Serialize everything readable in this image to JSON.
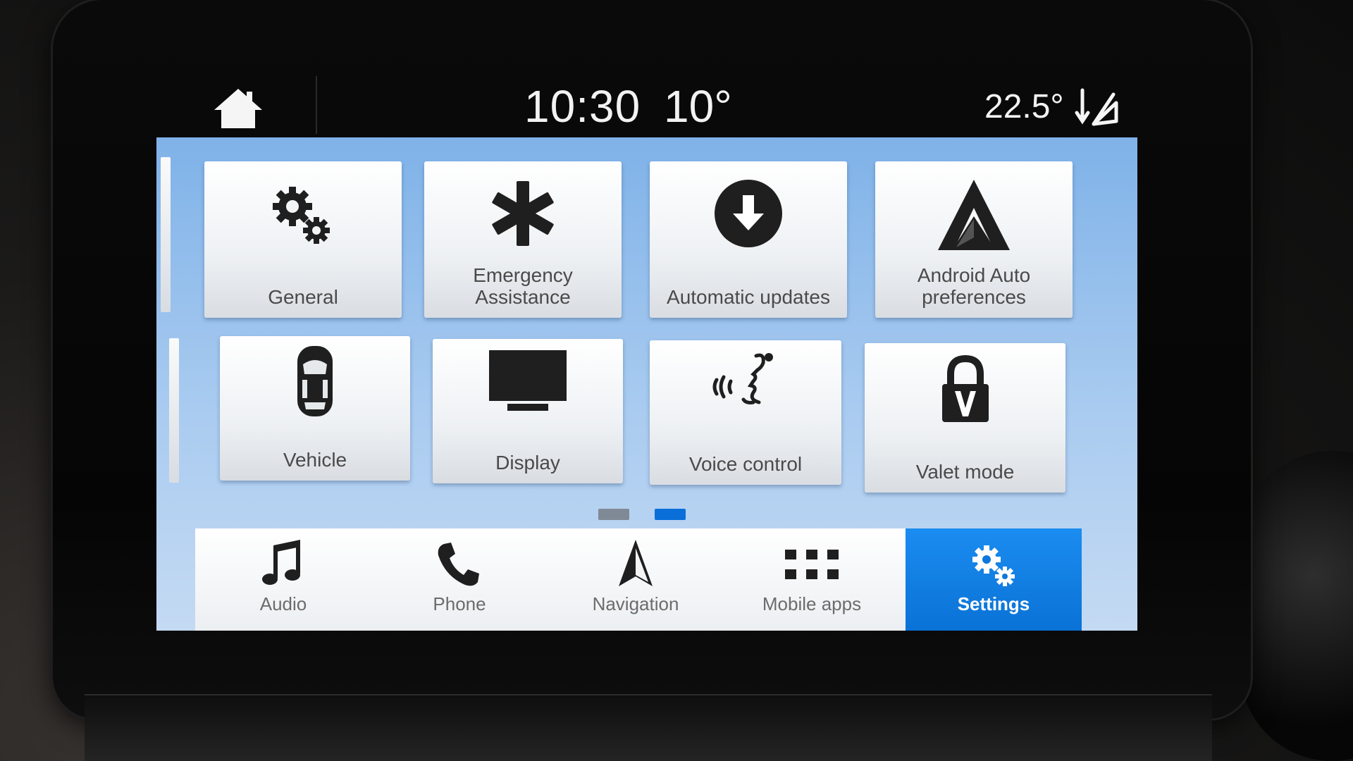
{
  "status_bar": {
    "time": "10:30",
    "outside_temperature": "10°",
    "cabin_temperature": "22.5°",
    "home_icon": "home-icon",
    "climate_icon": "airflow-icon"
  },
  "settings_grid": {
    "tiles": [
      {
        "label": "General",
        "icon": "gears-icon"
      },
      {
        "label": "Emergency\nAssistance",
        "icon": "asterisk-icon"
      },
      {
        "label": "Automatic updates",
        "icon": "download-circle-icon"
      },
      {
        "label": "Android Auto\npreferences",
        "icon": "android-auto-icon"
      },
      {
        "label": "Vehicle",
        "icon": "car-icon"
      },
      {
        "label": "Display",
        "icon": "monitor-icon"
      },
      {
        "label": "Voice control",
        "icon": "voice-icon"
      },
      {
        "label": "Valet mode",
        "icon": "lock-icon"
      }
    ]
  },
  "pager": {
    "pages": 2,
    "current_page": 2,
    "colors": {
      "inactive": "#808a96",
      "active": "#0a6fd8"
    }
  },
  "bottom_nav": {
    "items": [
      {
        "label": "Audio",
        "icon": "music-note-icon",
        "active": false
      },
      {
        "label": "Phone",
        "icon": "phone-icon",
        "active": false
      },
      {
        "label": "Navigation",
        "icon": "navigation-arrow-icon",
        "active": false
      },
      {
        "label": "Mobile apps",
        "icon": "apps-grid-icon",
        "active": false
      },
      {
        "label": "Settings",
        "icon": "gears-icon",
        "active": true
      }
    ]
  },
  "colors": {
    "accent": "#0a72d6",
    "background_top": "#7fb2e8",
    "icon": "#1f1f1f"
  }
}
